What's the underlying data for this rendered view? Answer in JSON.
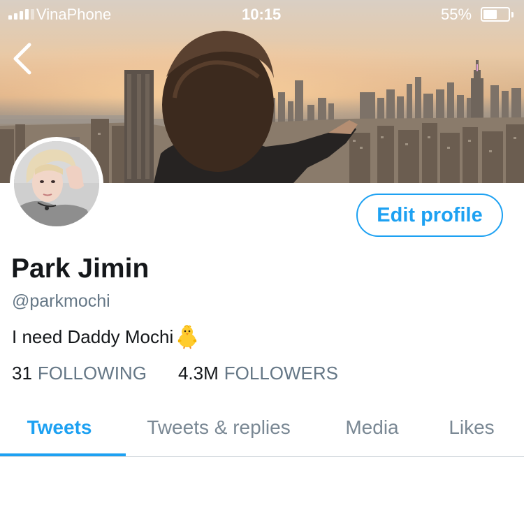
{
  "status_bar": {
    "carrier": "VinaPhone",
    "time": "10:15",
    "battery_percent": "55%",
    "battery_level": 0.55,
    "signal_bars": 4
  },
  "header": {
    "back_icon": "chevron-left-icon"
  },
  "profile": {
    "name": "Park Jimin",
    "handle": "@parkmochi",
    "bio": "I need Daddy Mochi",
    "bio_emoji": "baby-chick-emoji",
    "edit_button": "Edit profile",
    "following_count": "31",
    "following_label": "FOLLOWING",
    "followers_count": "4.3M",
    "followers_label": "FOLLOWERS"
  },
  "tabs": [
    {
      "label": "Tweets",
      "active": true
    },
    {
      "label": "Tweets & replies",
      "active": false
    },
    {
      "label": "Media",
      "active": false
    },
    {
      "label": "Likes",
      "active": false
    }
  ],
  "colors": {
    "accent": "#1da1f2",
    "text_primary": "#14171a",
    "text_secondary": "#657786"
  }
}
